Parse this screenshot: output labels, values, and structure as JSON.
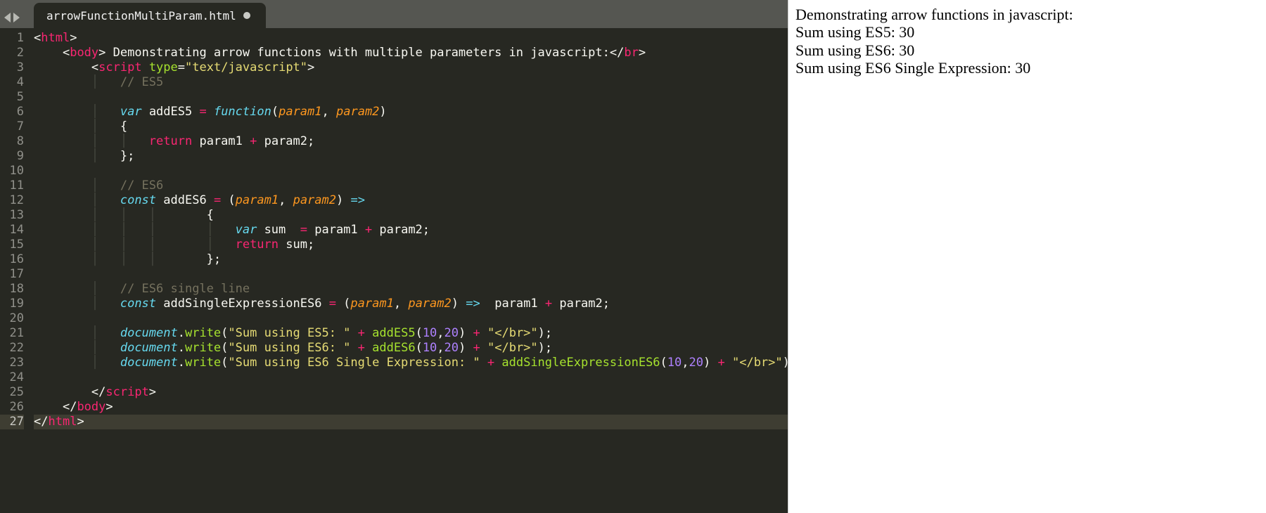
{
  "tab": {
    "title": "arrowFunctionMultiParam.html",
    "dirty": true
  },
  "gutter": {
    "count": 27,
    "current": 27
  },
  "code": {
    "l1": {
      "a": "<",
      "t": "html",
      "b": ">"
    },
    "l2": {
      "a": "<",
      "t": "body",
      "b": ">",
      "txt": " Demonstrating arrow functions with multiple parameters in javascript:",
      "c": "</",
      "t2": "br",
      "d": ">"
    },
    "l3": {
      "a": "<",
      "t": "script",
      "sp": " ",
      "attr": "type",
      "eq": "=",
      "q1": "\"",
      "val": "text/javascript",
      "q2": "\"",
      "b": ">"
    },
    "l4": {
      "c": "// ES5"
    },
    "l6": {
      "var": "var",
      "sp": " ",
      "name": "addES5",
      "eq": " = ",
      "fn": "function",
      "lp": "(",
      "p1": "param1",
      "comma": ", ",
      "p2": "param2",
      "rp": ")"
    },
    "l7": {
      "brace": "{"
    },
    "l8": {
      "ret": "return",
      "sp": " ",
      "p1": "param1",
      "op": " + ",
      "p2": "param2",
      "sc": ";"
    },
    "l9": {
      "brace": "};"
    },
    "l11": {
      "c": "// ES6"
    },
    "l12": {
      "const": "const",
      "sp": " ",
      "name": "addES6",
      "eq": " = ",
      "lp": "(",
      "p1": "param1",
      "comma": ", ",
      "p2": "param2",
      "rp": ")",
      "arrow": " =>"
    },
    "l13": {
      "brace": "{"
    },
    "l14": {
      "var": "var",
      "sp": " ",
      "name": "sum",
      "eq": "  = ",
      "p1": "param1",
      "op": " + ",
      "p2": "param2",
      "sc": ";"
    },
    "l15": {
      "ret": "return",
      "sp": " ",
      "name": "sum",
      "sc": ";"
    },
    "l16": {
      "brace": "};"
    },
    "l18": {
      "c": "// ES6 single line"
    },
    "l19": {
      "const": "const",
      "sp": " ",
      "name": "addSingleExpressionES6",
      "eq": " = ",
      "lp": "(",
      "p1": "param1",
      "comma": ", ",
      "p2": "param2",
      "rp": ")",
      "arrow": " => ",
      "sp2": " ",
      "p1b": "param1",
      "op": " + ",
      "p2b": "param2",
      "sc": ";"
    },
    "l21": {
      "obj": "document",
      "dot": ".",
      "fn": "write",
      "lp": "(",
      "s1": "\"Sum using ES5: \"",
      "op1": " + ",
      "call": "addES5",
      "lp2": "(",
      "n1": "10",
      "comma": ",",
      "n2": "20",
      "rp2": ")",
      "op2": " + ",
      "s2": "\"</br>\"",
      "rp": ")",
      "sc": ";"
    },
    "l22": {
      "obj": "document",
      "dot": ".",
      "fn": "write",
      "lp": "(",
      "s1": "\"Sum using ES6: \"",
      "op1": " + ",
      "call": "addES6",
      "lp2": "(",
      "n1": "10",
      "comma": ",",
      "n2": "20",
      "rp2": ")",
      "op2": " + ",
      "s2": "\"</br>\"",
      "rp": ")",
      "sc": ";"
    },
    "l23": {
      "obj": "document",
      "dot": ".",
      "fn": "write",
      "lp": "(",
      "s1": "\"Sum using ES6 Single Expression: \"",
      "op1": " + ",
      "call": "addSingleExpressionES6",
      "lp2": "(",
      "n1": "10",
      "comma": ",",
      "n2": "20",
      "rp2": ")",
      "op2": " + ",
      "s2": "\"</br>\"",
      "rp": ")",
      "sc": ";"
    },
    "l25": {
      "a": "</",
      "t": "script",
      "b": ">"
    },
    "l26": {
      "a": "</",
      "t": "body",
      "b": ">"
    },
    "l27": {
      "a": "</",
      "t": "html",
      "b": ">"
    }
  },
  "preview": {
    "line1": "Demonstrating arrow functions in javascript:",
    "line2": "Sum using ES5: 30",
    "line3": "Sum using ES6: 30",
    "line4": "Sum using ES6 Single Expression: 30"
  }
}
